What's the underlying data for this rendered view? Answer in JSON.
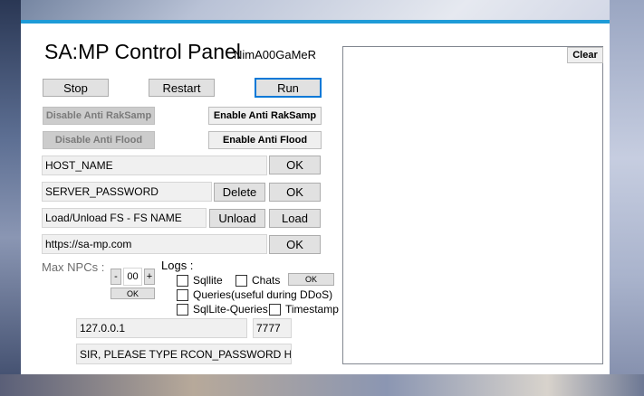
{
  "window": {
    "title": "SA:MP Control Panel",
    "subtitle": "NimA00GaMeR"
  },
  "controls": {
    "stop": "Stop",
    "restart": "Restart",
    "run": "Run",
    "disable_anti_raksamp": "Disable Anti RakSamp",
    "enable_anti_raksamp": "Enable Anti RakSamp",
    "disable_anti_flood": "Disable Anti Flood",
    "enable_anti_flood": "Enable Anti Flood"
  },
  "rows": {
    "host_name": {
      "value": "HOST_NAME",
      "ok": "OK"
    },
    "server_password": {
      "value": "SERVER_PASSWORD",
      "delete": "Delete",
      "ok": "OK"
    },
    "filterscript": {
      "value": "Load/Unload FS - FS NAME",
      "unload": "Unload",
      "load": "Load"
    },
    "website": {
      "value": "https://sa-mp.com",
      "ok": "OK"
    }
  },
  "npcs": {
    "label": "Max NPCs :",
    "minus": "-",
    "value": "00",
    "plus": "+",
    "ok": "OK"
  },
  "logs": {
    "label": "Logs :",
    "sqllite": {
      "label": "Sqllite",
      "checked": false
    },
    "chats": {
      "label": "Chats",
      "checked": false
    },
    "ok": "OK",
    "queries": {
      "label": "Queries(useful during DDoS)",
      "checked": false
    },
    "sqllite_queries": {
      "label": "SqlLite-Queries",
      "checked": false
    },
    "timestamp": {
      "label": "Timestamp",
      "checked": false
    }
  },
  "connection": {
    "ip": "127.0.0.1",
    "port": "7777",
    "rcon": "SIR, PLEASE TYPE RCON_PASSWORD HERE"
  },
  "output": {
    "clear": "Clear",
    "text": ""
  }
}
